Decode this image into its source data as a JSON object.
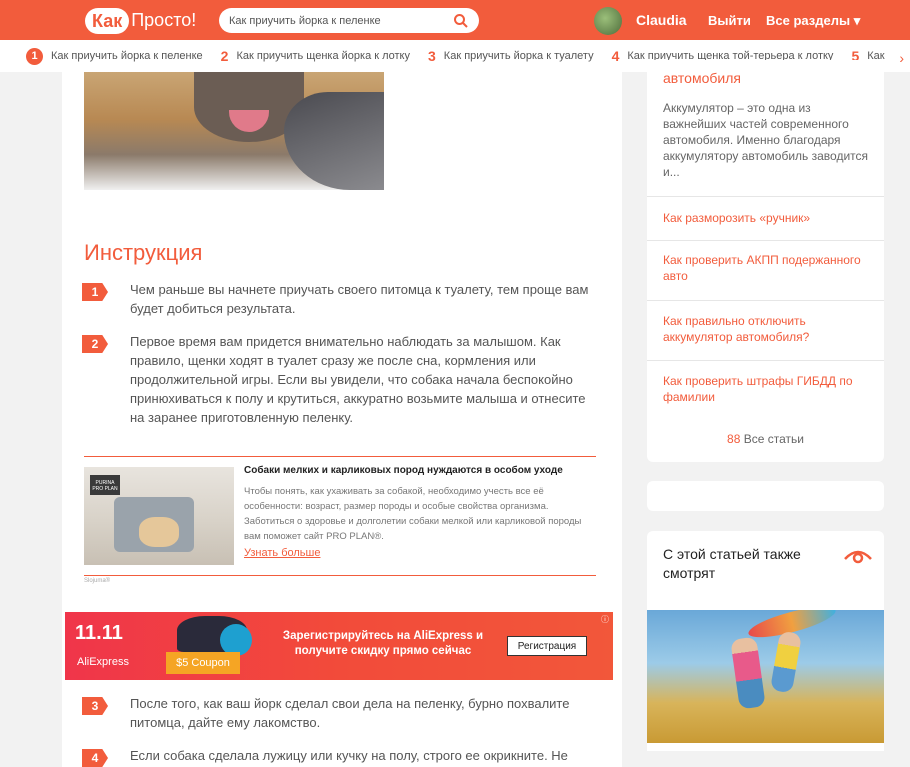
{
  "header": {
    "logo_part1": "Как",
    "logo_part2": "Просто!",
    "search_value": "Как приучить йорка к пеленке",
    "username": "Claudia",
    "logout": "Выйти",
    "sections": "Все разделы ▾"
  },
  "strip": [
    {
      "num": "1",
      "label": "Как приучить йорка к пеленке"
    },
    {
      "num": "2",
      "label": "Как приучить щенка йорка к лотку"
    },
    {
      "num": "3",
      "label": "Как приучить йорка к туалету"
    },
    {
      "num": "4",
      "label": "Как приучить щенка той-терьера к лотку"
    },
    {
      "num": "5",
      "label": "Как"
    }
  ],
  "strip_arrow": "›",
  "article": {
    "instruction_title": "Инструкция",
    "steps": [
      {
        "num": "1",
        "text": "Чем раньше вы начнете приучать своего питомца к туалету, тем проще вам будет добиться результата."
      },
      {
        "num": "2",
        "text": "Первое время вам придется внимательно наблюдать за малышом. Как правило, щенки ходят в туалет сразу же после сна, кормления или продолжительной игры. Если вы увидели, что собака начала беспокойно принюхиваться к полу и крутиться, аккуратно возьмите малыша и отнесите на заранее приготовленную пеленку."
      },
      {
        "num": "3",
        "text": "После того, как ваш йорк сделал свои дела на пеленку, бурно похвалите питомца, дайте ему лакомство."
      },
      {
        "num": "4",
        "text": "Если собака сделала лужицу или кучку на полу, строго ее окрикните. Не"
      }
    ],
    "promo": {
      "badge": "PURINA PRO PLAN",
      "title": "Собаки мелких и карликовых пород нуждаются в особом уходе",
      "body": "Чтобы понять, как ухаживать за собакой, необходимо учесть все её особенности: возраст, размер породы и особые свойства организма. Заботиться о здоровье и долголетии собаки мелкой или карликовой породы вам поможет сайт PRO PLAN®.",
      "link": "Узнать больше",
      "footnote": "Slojuma®"
    },
    "ad": {
      "logo": "11.11",
      "brand": "AliExpress",
      "coupon": "$5 Coupon",
      "text": "Зарегистрируйтесь на AliExpress и получите скидку прямо сейчас",
      "button": "Регистрация",
      "info": "ⓘ"
    }
  },
  "sidebar": {
    "card_title": "автомобиля",
    "card_desc": "Аккумулятор – это одна из важнейших частей современного автомобиля. Именно благодаря аккумулятору автомобиль заводится и...",
    "links": [
      "Как разморозить «ручник»",
      "Как проверить АКПП подержанного авто",
      "Как правильно отключить аккумулятор автомобиля?",
      "Как проверить штрафы ГИБДД по фамилии"
    ],
    "all_icon": "88",
    "all_label": "Все статьи",
    "also_watch": "С этой статьей также смотрят"
  },
  "colors": {
    "accent": "#f25c3c"
  }
}
